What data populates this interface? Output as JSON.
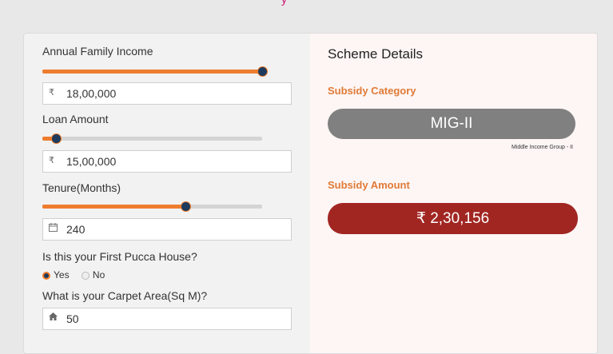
{
  "form": {
    "income_label": "Annual Family Income",
    "income_currency": "₹",
    "income_value": "18,00,000",
    "income_slider_level": 1.0,
    "loan_label": "Loan Amount",
    "loan_currency": "₹",
    "loan_value": "15,00,000",
    "loan_slider_level": 0.06,
    "tenure_label": "Tenure(Months)",
    "tenure_value": "240",
    "tenure_slider_level": 0.65,
    "first_house_label": "Is this your First Pucca House?",
    "yes_label": "Yes",
    "no_label": "No",
    "selected": "Yes",
    "carpet_label": "What is your Carpet Area(Sq M)?",
    "carpet_value": "50"
  },
  "scheme": {
    "title": "Scheme Details",
    "category_label": "Subsidy Category",
    "category_value": "MIG-II",
    "category_desc": "Middle Income Group - II",
    "amount_label": "Subsidy Amount",
    "amount_value": "₹ 2,30,156"
  },
  "colors": {
    "accent": "#ee7d2e",
    "knob": "#1e3a5c",
    "category_pill": "#808080",
    "amount_pill": "#a12622"
  }
}
